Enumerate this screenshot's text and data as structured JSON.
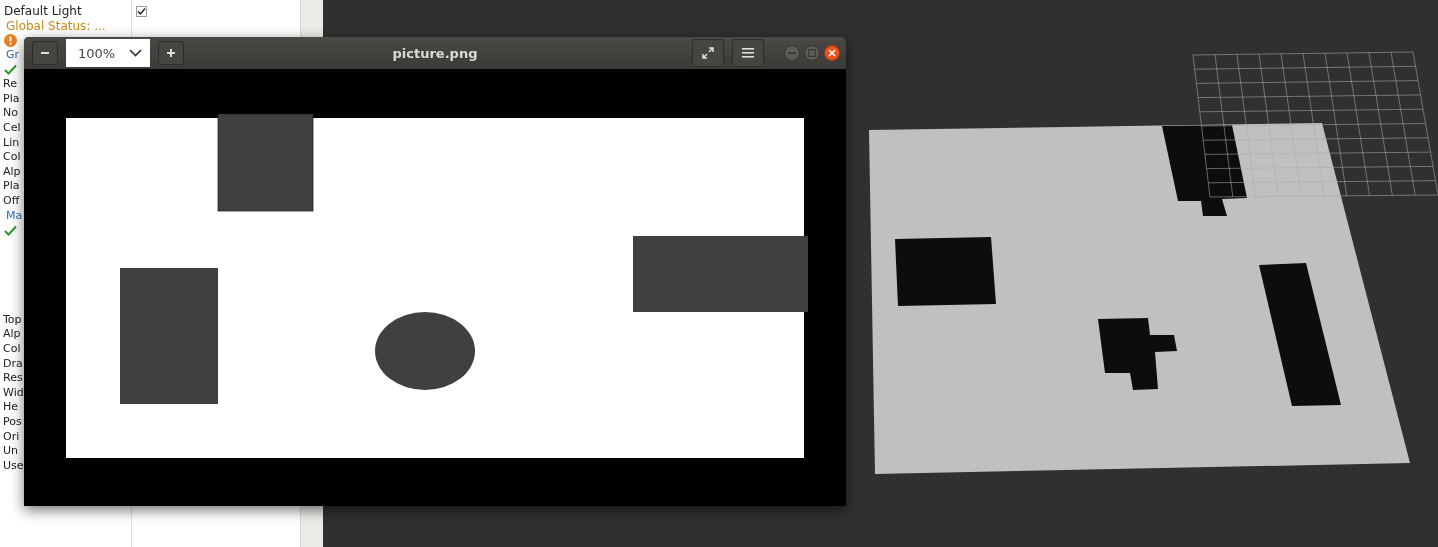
{
  "properties": {
    "upper": [
      {
        "kind": "check",
        "label": "Default Light",
        "checked": true
      },
      {
        "kind": "status",
        "label": "Global Status: ..."
      },
      {
        "kind": "warning"
      },
      {
        "kind": "group",
        "label": "Gr"
      },
      {
        "kind": "ok"
      },
      {
        "kind": "text",
        "label": "Re"
      },
      {
        "kind": "text",
        "label": "Pla"
      },
      {
        "kind": "text",
        "label": "No"
      },
      {
        "kind": "text",
        "label": "Cel"
      },
      {
        "kind": "text",
        "label": "Lin"
      },
      {
        "kind": "text",
        "label": "Col"
      },
      {
        "kind": "text",
        "label": "Alp"
      },
      {
        "kind": "text",
        "label": "Pla"
      },
      {
        "kind": "text",
        "label": "Off"
      },
      {
        "kind": "group",
        "label": "Ma"
      },
      {
        "kind": "ok"
      }
    ],
    "lower": [
      {
        "kind": "text",
        "label": "Top"
      },
      {
        "kind": "text",
        "label": "Alp"
      },
      {
        "kind": "text",
        "label": "Col"
      },
      {
        "kind": "text",
        "label": "Dra"
      },
      {
        "kind": "text",
        "label": "Res"
      },
      {
        "kind": "text",
        "label": "Wid"
      },
      {
        "kind": "text",
        "label": "He"
      },
      {
        "kind": "text",
        "label": "Pos"
      },
      {
        "kind": "text",
        "label": "Ori"
      },
      {
        "kind": "text",
        "label": "Un"
      },
      {
        "kind": "text",
        "label": "Use"
      }
    ]
  },
  "viewer": {
    "title": "picture.png",
    "zoom": "100%"
  }
}
